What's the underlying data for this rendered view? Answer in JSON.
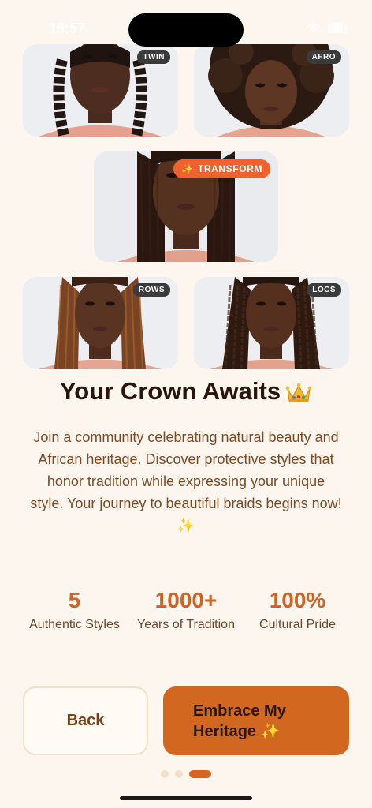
{
  "status_bar": {
    "time": "19:57"
  },
  "gallery": [
    {
      "tag": "TWIN",
      "hair": "twists"
    },
    {
      "tag": "AFRO",
      "hair": "afro"
    },
    {
      "tag": "TRANSFORM",
      "hair": "braids"
    },
    {
      "tag": "ROWS",
      "hair": "braids"
    },
    {
      "tag": "LOCS",
      "hair": "locs"
    }
  ],
  "title": "Your Crown Awaits",
  "description": "Join a community celebrating natural beauty and African heritage. Discover protective styles that honor tradition while expressing your unique style. Your journey to beautiful braids begins now! ✨",
  "stats": [
    {
      "value": "5",
      "label": "Authentic Styles"
    },
    {
      "value": "1000+",
      "label": "Years of Tradition"
    },
    {
      "value": "100%",
      "label": "Cultural Pride"
    }
  ],
  "buttons": {
    "back": "Back",
    "embrace": "Embrace My Heritage ✨"
  },
  "pagination": {
    "total": 3,
    "active": 3
  },
  "colors": {
    "background": "#fdf6ee",
    "accent": "#d26720",
    "transform_badge": "#f0622d",
    "tag_bg": "#3b3b3b"
  }
}
